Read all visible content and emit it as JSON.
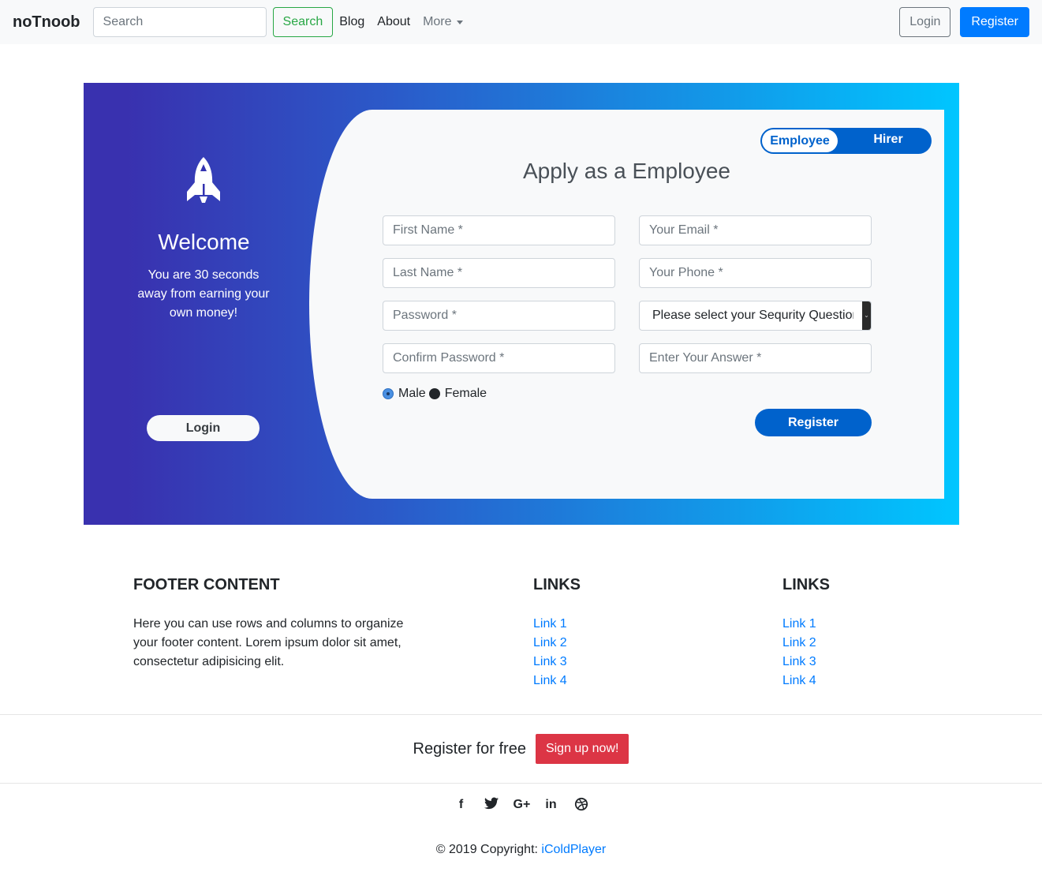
{
  "navbar": {
    "brand": "noTnoob",
    "search_placeholder": "Search",
    "search_button": "Search",
    "links": [
      "Blog",
      "About"
    ],
    "more": "More",
    "login": "Login",
    "register": "Register"
  },
  "left_panel": {
    "icon": "rocket-icon",
    "welcome": "Welcome",
    "tagline": "You are 30 seconds away from earning your own money!",
    "login_button": "Login"
  },
  "form": {
    "toggle": {
      "active": "Employee",
      "inactive": "Hirer"
    },
    "heading": "Apply as a Employee",
    "placeholders": {
      "first_name": "First Name *",
      "last_name": "Last Name *",
      "password": "Password *",
      "confirm_password": "Confirm Password *",
      "email": "Your Email *",
      "phone": "Your Phone *",
      "answer": "Enter Your Answer *"
    },
    "security_question": "Please select your Sequrity Question",
    "gender": {
      "options": [
        "Male",
        "Female"
      ],
      "selected": "Male"
    },
    "register_button": "Register"
  },
  "footer": {
    "title": "FOOTER CONTENT",
    "text": "Here you can use rows and columns to organize your footer content. Lorem ipsum dolor sit amet, consectetur adipisicing elit.",
    "link_columns": [
      {
        "title": "LINKS",
        "links": [
          "Link 1",
          "Link 2",
          "Link 3",
          "Link 4"
        ]
      },
      {
        "title": "LINKS",
        "links": [
          "Link 1",
          "Link 2",
          "Link 3",
          "Link 4"
        ]
      }
    ],
    "cta_text": "Register for free",
    "cta_button": "Sign up now!",
    "social_icons": [
      "facebook-icon",
      "twitter-icon",
      "google-plus-icon",
      "linkedin-icon",
      "dribbble-icon"
    ],
    "copyright_prefix": "© 2019 Copyright:",
    "copyright_link": "iColdPlayer"
  },
  "colors": {
    "primary": "#007bff",
    "form_blue": "#0062cc",
    "gradient_start": "#3931af",
    "gradient_end": "#00c6ff",
    "danger": "#dc3545",
    "success": "#28a745"
  }
}
